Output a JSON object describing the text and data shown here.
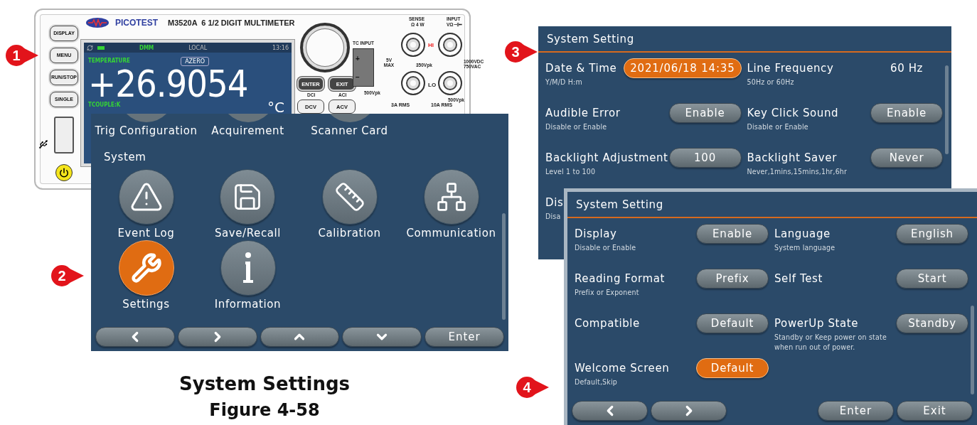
{
  "instrument": {
    "brand": "PICOTEST",
    "model": "M3520A  6 1/2 DIGIT MULTIMETER",
    "front_buttons": [
      "DISPLAY",
      "MENU",
      "RUN/STOP",
      "SINGLE"
    ],
    "screen": {
      "mode": "DMM",
      "remote": "LOCAL",
      "time": "13:16",
      "function": "TEMPERATURE",
      "badge": "AZERO",
      "reading": "+26.9054",
      "sensor": "TCOUPLE:K",
      "unit": "°C"
    },
    "keys": [
      "ENTER",
      "EXIT"
    ],
    "key_captions": [
      "DCI",
      "ACI"
    ],
    "range_keys": [
      "DCV",
      "ACV"
    ],
    "tc_input": {
      "title": "TC INPUT",
      "plus": "+",
      "minus": "−",
      "rating": "5V MAX",
      "ground_rating": "500Vpk"
    },
    "terminals": {
      "sense": "SENSE",
      "sense_sub": "Ω 4 W",
      "input": "INPUT",
      "input_sub": "VΩ⊣⊢",
      "hi": "HI",
      "lo": "LO",
      "mid_rating": "350Vpk",
      "max_rating": "1000VDC 750VAC",
      "low_rating": "500Vpk",
      "current_a": "3A RMS",
      "current_b": "10A RMS"
    }
  },
  "menu_screen": {
    "top_items": [
      "Trig Configuration",
      "Acquirement",
      "Scanner Card"
    ],
    "section": "System",
    "items": [
      {
        "label": "Event Log",
        "selected": false
      },
      {
        "label": "Save/Recall",
        "selected": false
      },
      {
        "label": "Calibration",
        "selected": false
      },
      {
        "label": "Communication",
        "selected": false
      },
      {
        "label": "Settings",
        "selected": true
      },
      {
        "label": "Information",
        "selected": false
      }
    ],
    "nav": [
      {
        "kind": "left"
      },
      {
        "kind": "right"
      },
      {
        "kind": "up"
      },
      {
        "kind": "down"
      },
      {
        "kind": "text",
        "label": "Enter"
      }
    ]
  },
  "settings_screens": [
    {
      "title": "System Setting",
      "items": [
        {
          "label": "Date & Time",
          "hint": "Y/M/D H:m",
          "value": "2021/06/18 14:35",
          "kind": "button",
          "selected": true
        },
        {
          "label": "Line Frequency",
          "hint": "50Hz or 60Hz",
          "value": "60 Hz",
          "kind": "text"
        },
        {
          "label": "Audible Error",
          "hint": "Disable or Enable",
          "value": "Enable",
          "kind": "button",
          "selected": false
        },
        {
          "label": "Key Click Sound",
          "hint": "Disable or Enable",
          "value": "Enable",
          "kind": "button",
          "selected": false
        },
        {
          "label": "Backlight Adjustment",
          "hint": "Level 1 to 100",
          "value": "100",
          "kind": "button",
          "selected": false
        },
        {
          "label": "Backlight Saver",
          "hint": "Never,1mins,15mins,1hr,6hr",
          "value": "Never",
          "kind": "button",
          "selected": false
        },
        {
          "label": "Dis",
          "hint": "Disa",
          "kind": "partial"
        }
      ]
    },
    {
      "title": "System Setting",
      "items": [
        {
          "label": "Display",
          "hint": "Disable or Enable",
          "value": "Enable",
          "kind": "button",
          "selected": false
        },
        {
          "label": "Language",
          "hint": "System language",
          "value": "English",
          "kind": "button",
          "selected": false
        },
        {
          "label": "Reading Format",
          "hint": "Prefix or Exponent",
          "value": "Prefix",
          "kind": "button",
          "selected": false
        },
        {
          "label": "Self Test",
          "value": "Start",
          "kind": "button",
          "selected": false
        },
        {
          "label": "Compatible",
          "value": "Default",
          "kind": "button",
          "selected": false
        },
        {
          "label": "PowerUp State",
          "hint": "Standby or Keep power on state when run out of power.",
          "value": "Standby",
          "kind": "button",
          "selected": false
        },
        {
          "label": "Welcome Screen",
          "hint": "Default,Skip",
          "value": "Default",
          "kind": "button",
          "selected": true
        }
      ],
      "nav": [
        {
          "kind": "left"
        },
        {
          "kind": "right"
        },
        {
          "kind": "gap"
        },
        {
          "kind": "text",
          "label": "Enter"
        },
        {
          "kind": "text",
          "label": "Exit"
        }
      ]
    }
  ],
  "callouts": [
    "1",
    "2",
    "3",
    "4"
  ],
  "caption": {
    "title": "System Settings",
    "figure": "Figure 4-58"
  }
}
